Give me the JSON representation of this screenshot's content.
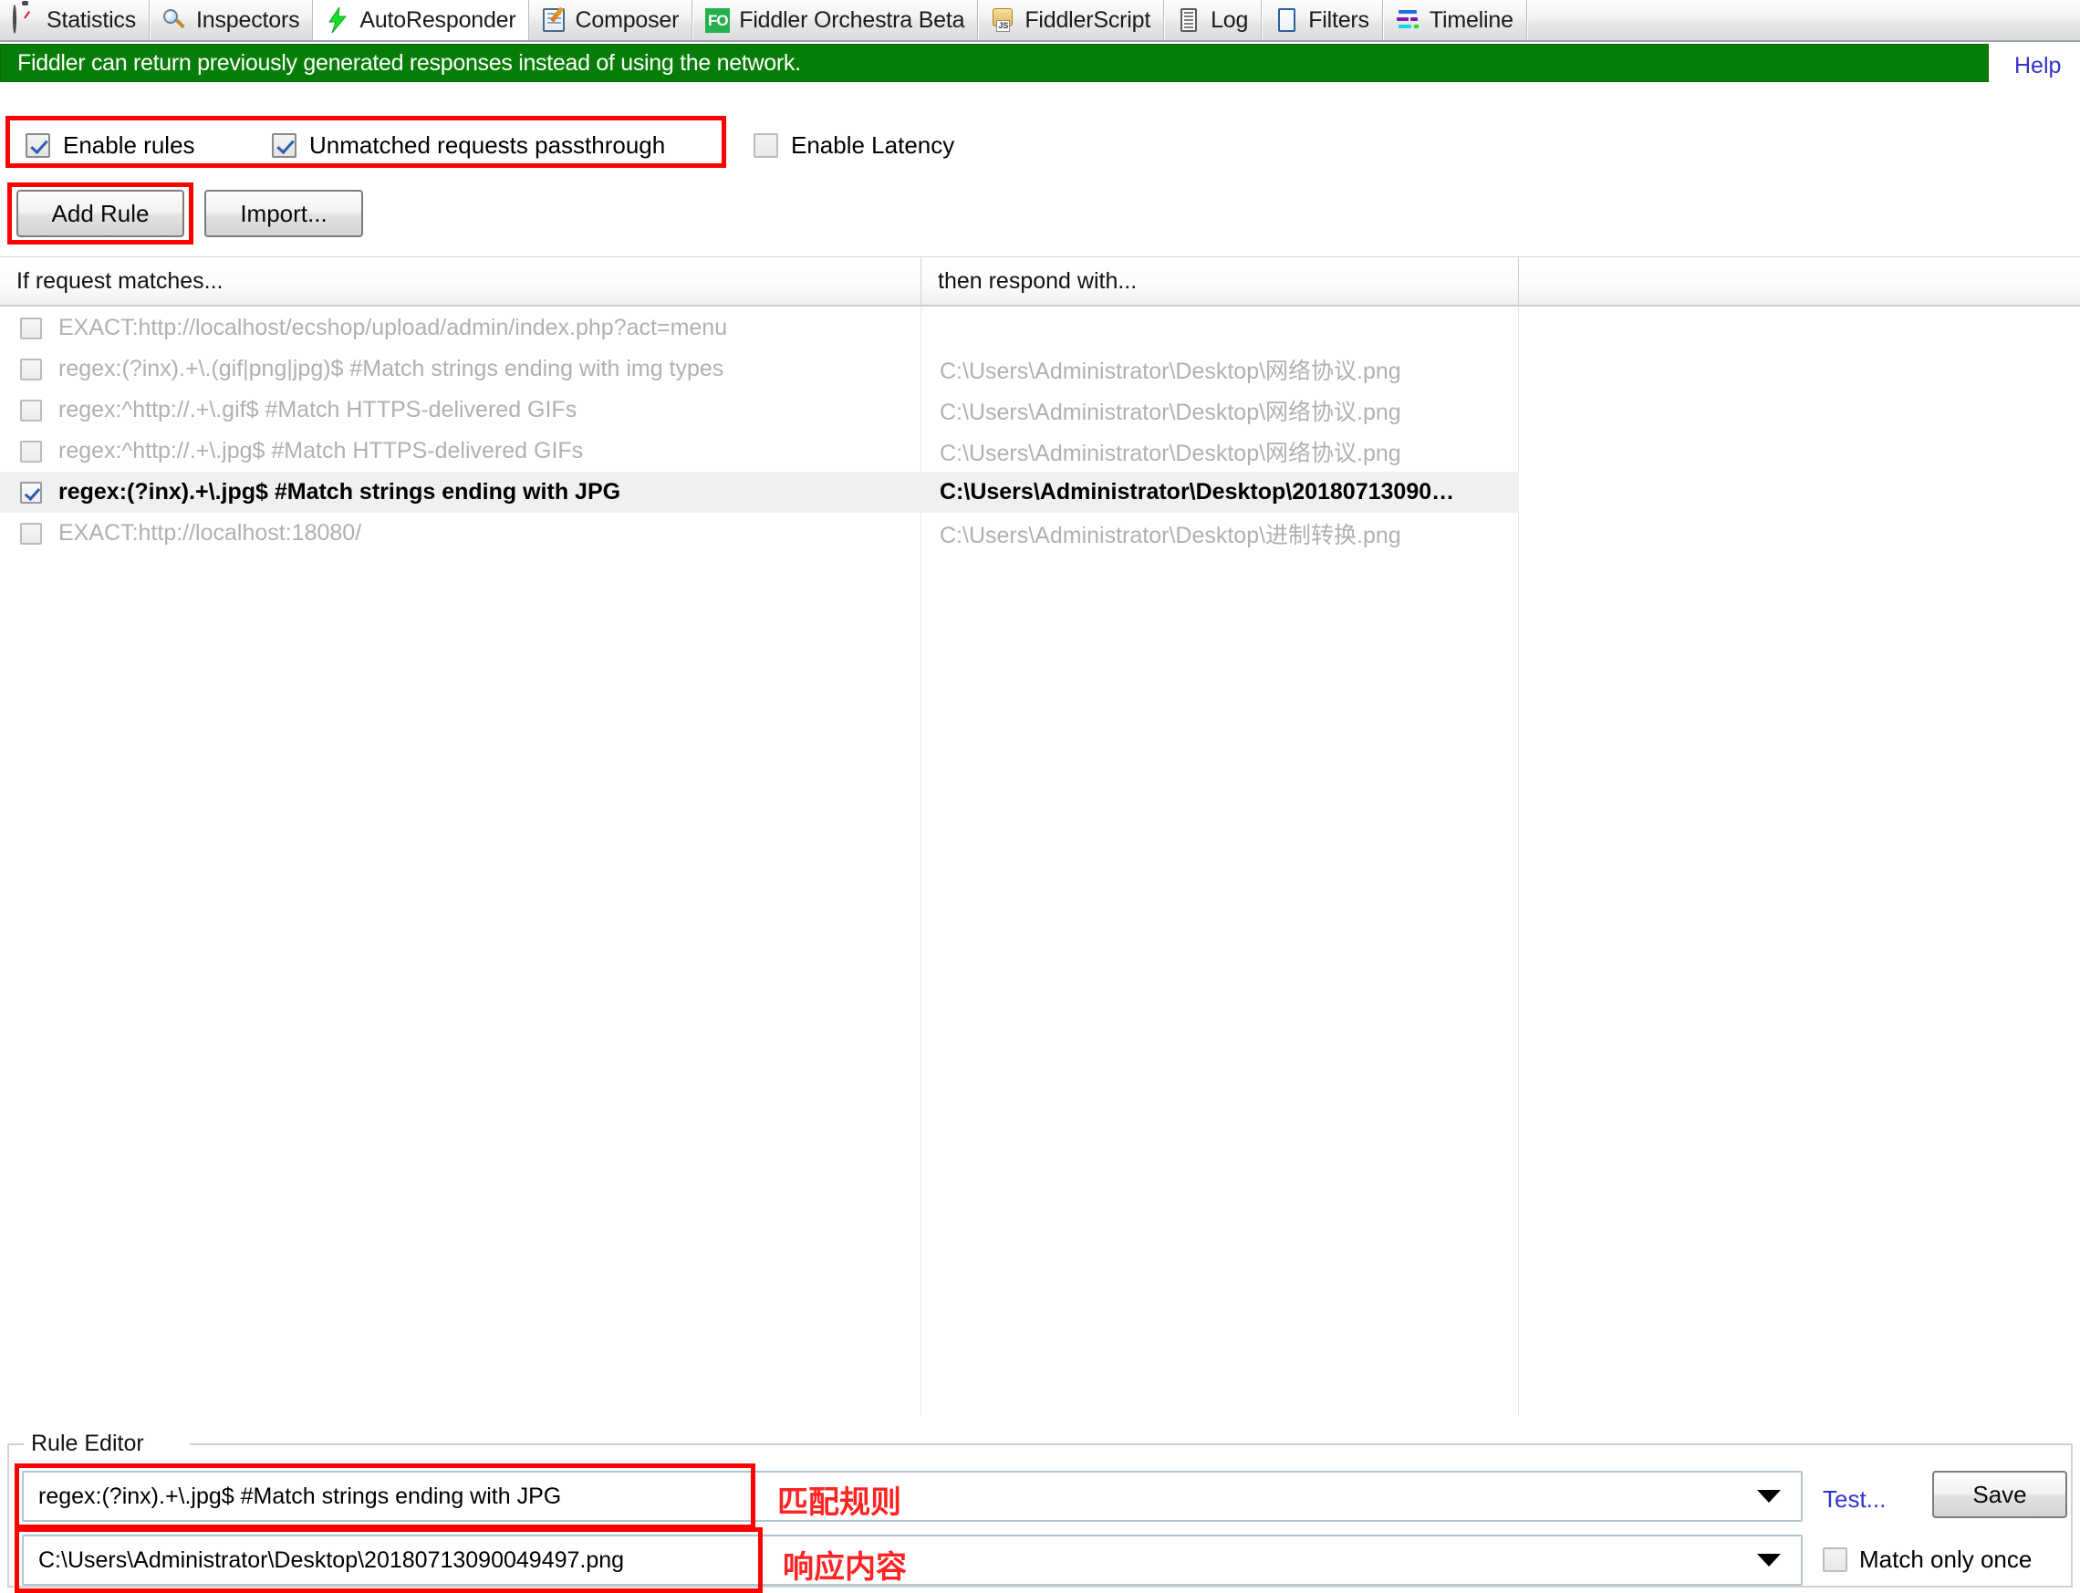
{
  "tabs": [
    {
      "label": "Statistics",
      "icon": "stopwatch-icon",
      "selected": false
    },
    {
      "label": "Inspectors",
      "icon": "magnifier-icon",
      "selected": false
    },
    {
      "label": "AutoResponder",
      "icon": "lightning-bolt-icon",
      "selected": true
    },
    {
      "label": "Composer",
      "icon": "notepad-pencil-icon",
      "selected": false
    },
    {
      "label": "Fiddler Orchestra Beta",
      "icon": "fo-badge-icon",
      "selected": false
    },
    {
      "label": "FiddlerScript",
      "icon": "script-scroll-icon",
      "selected": false
    },
    {
      "label": "Log",
      "icon": "log-lines-icon",
      "selected": false
    },
    {
      "label": "Filters",
      "icon": "filter-panel-icon",
      "selected": false
    },
    {
      "label": "Timeline",
      "icon": "timeline-bars-icon",
      "selected": false
    }
  ],
  "banner": {
    "text": "Fiddler can return previously generated responses instead of using the network.",
    "help_label": "Help",
    "background_color": "#067d06",
    "help_color": "#3333cc"
  },
  "options": [
    {
      "label": "Enable rules",
      "checked": true,
      "enabled": true
    },
    {
      "label": "Unmatched requests passthrough",
      "checked": true,
      "enabled": true
    },
    {
      "label": "Enable Latency",
      "checked": false,
      "enabled": false
    }
  ],
  "toolbar": {
    "add_rule_label": "Add Rule",
    "import_label": "Import..."
  },
  "table": {
    "columns": [
      "If request matches...",
      "then respond with..."
    ],
    "rows": [
      {
        "checked": false,
        "match": "EXACT:http://localhost/ecshop/upload/admin/index.php?act=menu",
        "respond": "",
        "selected": false
      },
      {
        "checked": false,
        "match": "regex:(?inx).+\\.(gif|png|jpg)$ #Match strings ending with img types",
        "respond": "C:\\Users\\Administrator\\Desktop\\网络协议.png",
        "selected": false
      },
      {
        "checked": false,
        "match": "regex:^http://.+\\.gif$ #Match HTTPS-delivered GIFs",
        "respond": "C:\\Users\\Administrator\\Desktop\\网络协议.png",
        "selected": false
      },
      {
        "checked": false,
        "match": "regex:^http://.+\\.jpg$ #Match HTTPS-delivered GIFs",
        "respond": "C:\\Users\\Administrator\\Desktop\\网络协议.png",
        "selected": false
      },
      {
        "checked": true,
        "match": "regex:(?inx).+\\.jpg$ #Match strings ending with JPG",
        "respond": "C:\\Users\\Administrator\\Desktop\\20180713090…",
        "selected": true
      },
      {
        "checked": false,
        "match": "EXACT:http://localhost:18080/",
        "respond": "C:\\Users\\Administrator\\Desktop\\进制转换.png",
        "selected": false
      }
    ]
  },
  "rule_editor": {
    "group_label": "Rule Editor",
    "match_value": "regex:(?inx).+\\.jpg$ #Match strings ending with JPG",
    "respond_value": "C:\\Users\\Administrator\\Desktop\\20180713090049497.png",
    "match_note": "匹配规则",
    "respond_note": "响应内容",
    "test_label": "Test...",
    "save_label": "Save",
    "match_only_once_label": "Match only once",
    "match_only_once_checked": false
  },
  "annotation_color": "#ff0000"
}
